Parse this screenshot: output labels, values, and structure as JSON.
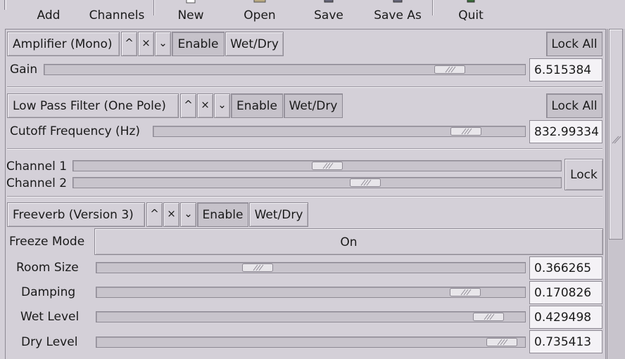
{
  "toolbar": {
    "buttons": [
      {
        "label": "Add",
        "icon": "add-icon"
      },
      {
        "label": "Channels",
        "icon": "channels-icon"
      },
      {
        "label": "New",
        "icon": "new-document-icon"
      },
      {
        "label": "Open",
        "icon": "open-folder-icon"
      },
      {
        "label": "Save",
        "icon": "save-icon"
      },
      {
        "label": "Save As",
        "icon": "save-as-icon"
      },
      {
        "label": "Quit",
        "icon": "quit-icon"
      }
    ]
  },
  "plugins": [
    {
      "title": "Amplifier (Mono)",
      "up": "^",
      "remove": "×",
      "down": "⌄",
      "enable": "Enable",
      "wetdry": "Wet/Dry",
      "lock": "Lock All",
      "controls": [
        {
          "label": "Gain",
          "value": "6.515384",
          "position": 0.845
        }
      ]
    },
    {
      "title": "Low Pass Filter (One Pole)",
      "up": "^",
      "remove": "×",
      "down": "⌄",
      "enable": "Enable",
      "wetdry": "Wet/Dry",
      "lock": "Lock All",
      "controls": [
        {
          "label": "Cutoff Frequency (Hz)",
          "value": "832.99334",
          "position": 0.86
        }
      ]
    }
  ],
  "channels": {
    "lock": "Lock",
    "items": [
      {
        "label": "Channel 1",
        "position": 0.52
      },
      {
        "label": "Channel 2",
        "position": 0.59
      }
    ]
  },
  "freeverb": {
    "title": "Freeverb (Version 3)",
    "up": "^",
    "remove": "×",
    "down": "⌄",
    "enable": "Enable",
    "wetdry": "Wet/Dry",
    "freeze": {
      "label": "Freeze Mode",
      "value": "On"
    },
    "controls": [
      {
        "label": "Room Size",
        "value": "0.366265",
        "position": 0.38
      },
      {
        "label": "Damping",
        "value": "0.170826",
        "position": 0.86
      },
      {
        "label": "Wet Level",
        "value": "0.429498",
        "position": 0.92
      },
      {
        "label": "Dry Level",
        "value": "0.735413",
        "position": 0.95
      }
    ]
  },
  "colors": {
    "background": "#d4d0d8",
    "trough": "#c8c4cc",
    "entry": "#f4f2f6",
    "border": "#8e8a94"
  }
}
